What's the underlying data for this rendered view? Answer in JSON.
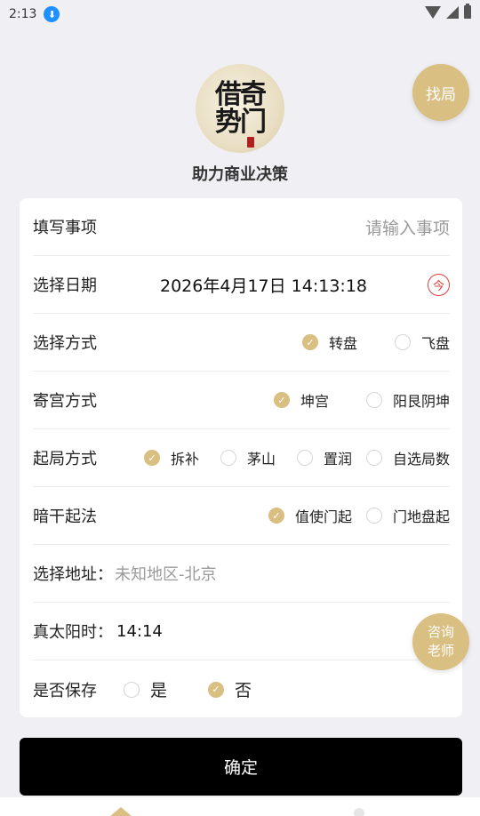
{
  "status_bar": {
    "time": "2:13",
    "download_icon": "download-icon"
  },
  "header": {
    "logo_line1": "借奇",
    "logo_line2": "势门",
    "tagline": "助力商业决策",
    "find_button": "找局"
  },
  "form": {
    "item": {
      "label": "填写事项",
      "placeholder": "请输入事项"
    },
    "date": {
      "label": "选择日期",
      "value": "2026年4月17日 14:13:18",
      "now_label": "今"
    },
    "method": {
      "label": "选择方式",
      "options": [
        {
          "label": "转盘",
          "selected": true
        },
        {
          "label": "飞盘",
          "selected": false
        }
      ]
    },
    "palace": {
      "label": "寄宫方式",
      "options": [
        {
          "label": "坤宫",
          "selected": true
        },
        {
          "label": "阳艮阴坤",
          "selected": false
        }
      ]
    },
    "start": {
      "label": "起局方式",
      "options": [
        {
          "label": "拆补",
          "selected": true
        },
        {
          "label": "茅山",
          "selected": false
        },
        {
          "label": "置润",
          "selected": false
        },
        {
          "label": "自选局数",
          "selected": false
        }
      ]
    },
    "hidden": {
      "label": "暗干起法",
      "options": [
        {
          "label": "值使门起",
          "selected": true
        },
        {
          "label": "门地盘起",
          "selected": false
        }
      ]
    },
    "address": {
      "label": "选择地址：",
      "value": "未知地区-北京"
    },
    "solar": {
      "label": "真太阳时：",
      "value": "14:14"
    },
    "save": {
      "label": "是否保存",
      "options": [
        {
          "label": "是",
          "selected": false
        },
        {
          "label": "否",
          "selected": true
        }
      ]
    }
  },
  "consult_button": {
    "line1": "咨询",
    "line2": "老师"
  },
  "confirm_button": "确定",
  "colors": {
    "accent": "#d9bf82",
    "primary_button": "#000000",
    "background": "#f0eff4"
  }
}
